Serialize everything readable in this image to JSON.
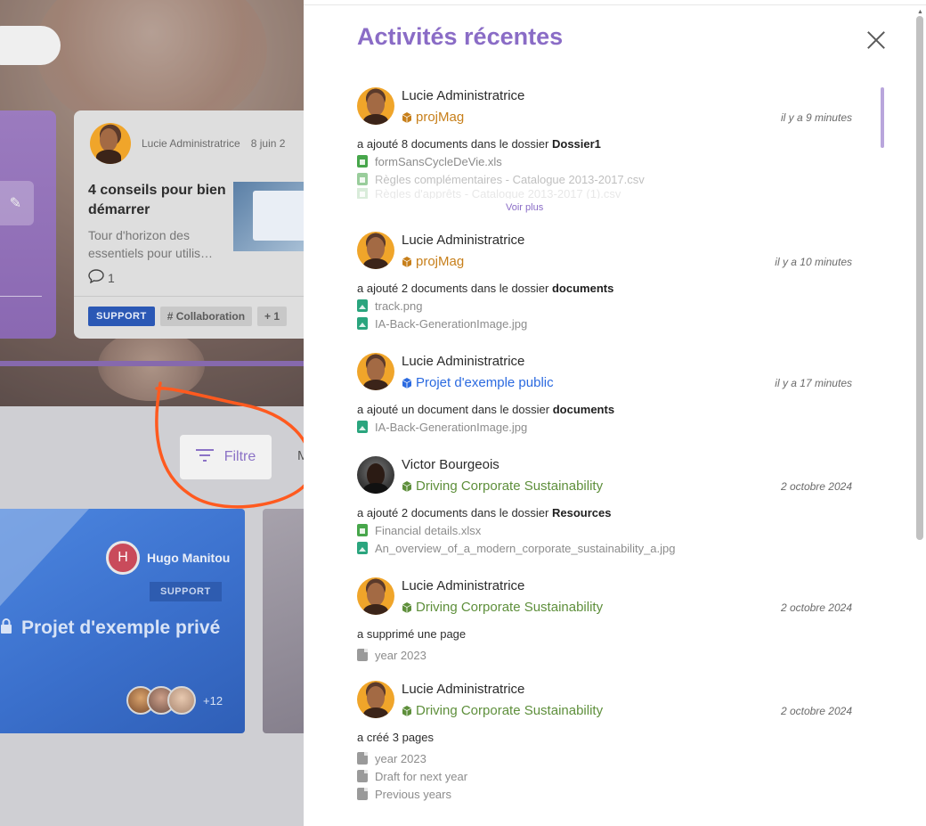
{
  "background": {
    "post_card": {
      "author": "Lucie Administratrice",
      "date": "8 juin 2",
      "title": "4 conseils pour bien démarrer",
      "description": "Tour d'horizon des essentiels pour utilis…",
      "comments": "1",
      "tags": [
        "SUPPORT",
        "# Collaboration",
        "+ 1"
      ]
    },
    "filter_label": "Filtre",
    "next_button_letter": "M",
    "project_card": {
      "owner_initial": "H",
      "owner_name": "Hugo Manitou",
      "tag": "SUPPORT",
      "title": "Projet d'exemple privé",
      "members_more": "+12"
    }
  },
  "drawer": {
    "title": "Activités récentes",
    "see_more": "Voir plus",
    "activities": [
      {
        "user": "Lucie Administratrice",
        "project": "projMag",
        "time": "il y a 9 minutes",
        "desc_prefix": "a ajouté 8 documents dans le dossier",
        "desc_target": "Dossier1",
        "files": [
          "formSansCycleDeVie.xls",
          "Règles complémentaires - Catalogue 2013-2017.csv",
          "Règles d'apprêts - Catalogue 2013-2017 (1).csv"
        ]
      },
      {
        "user": "Lucie Administratrice",
        "project": "projMag",
        "time": "il y a 10 minutes",
        "desc_prefix": "a ajouté 2 documents dans le dossier",
        "desc_target": "documents",
        "files": [
          "track.png",
          "IA-Back-GenerationImage.jpg"
        ]
      },
      {
        "user": "Lucie Administratrice",
        "project": "Projet d'exemple public",
        "time": "il y a 17 minutes",
        "desc_prefix": "a ajouté un document dans le dossier",
        "desc_target": "documents",
        "files": [
          "IA-Back-GenerationImage.jpg"
        ]
      },
      {
        "user": "Victor Bourgeois",
        "project": "Driving Corporate Sustainability",
        "time": "2 octobre 2024",
        "desc_prefix": "a ajouté 2 documents dans le dossier",
        "desc_target": "Resources",
        "files": [
          "Financial details.xlsx",
          "An_overview_of_a_modern_corporate_sustainability_a.jpg"
        ]
      },
      {
        "user": "Lucie Administratrice",
        "project": "Driving Corporate Sustainability",
        "time": "2 octobre 2024",
        "desc_prefix": "a supprimé une page",
        "desc_target": "",
        "files": [
          "year 2023"
        ]
      },
      {
        "user": "Lucie Administratrice",
        "project": "Driving Corporate Sustainability",
        "time": "2 octobre 2024",
        "desc_prefix": "a créé 3 pages",
        "desc_target": "",
        "files": [
          "year 2023",
          "Draft for next year",
          "Previous years"
        ]
      }
    ]
  },
  "colors": {
    "accent_purple": "#8a6cc6",
    "project_orange": "#c77f1a",
    "project_blue": "#2b6ae0",
    "project_green": "#5e8f3b",
    "annotation_orange": "#ff5a1f"
  },
  "icons": [
    "close-icon",
    "filter-icon",
    "cube-icon",
    "spreadsheet-file-icon",
    "image-file-icon",
    "page-icon",
    "comment-icon",
    "lock-icon",
    "pencil-icon"
  ]
}
